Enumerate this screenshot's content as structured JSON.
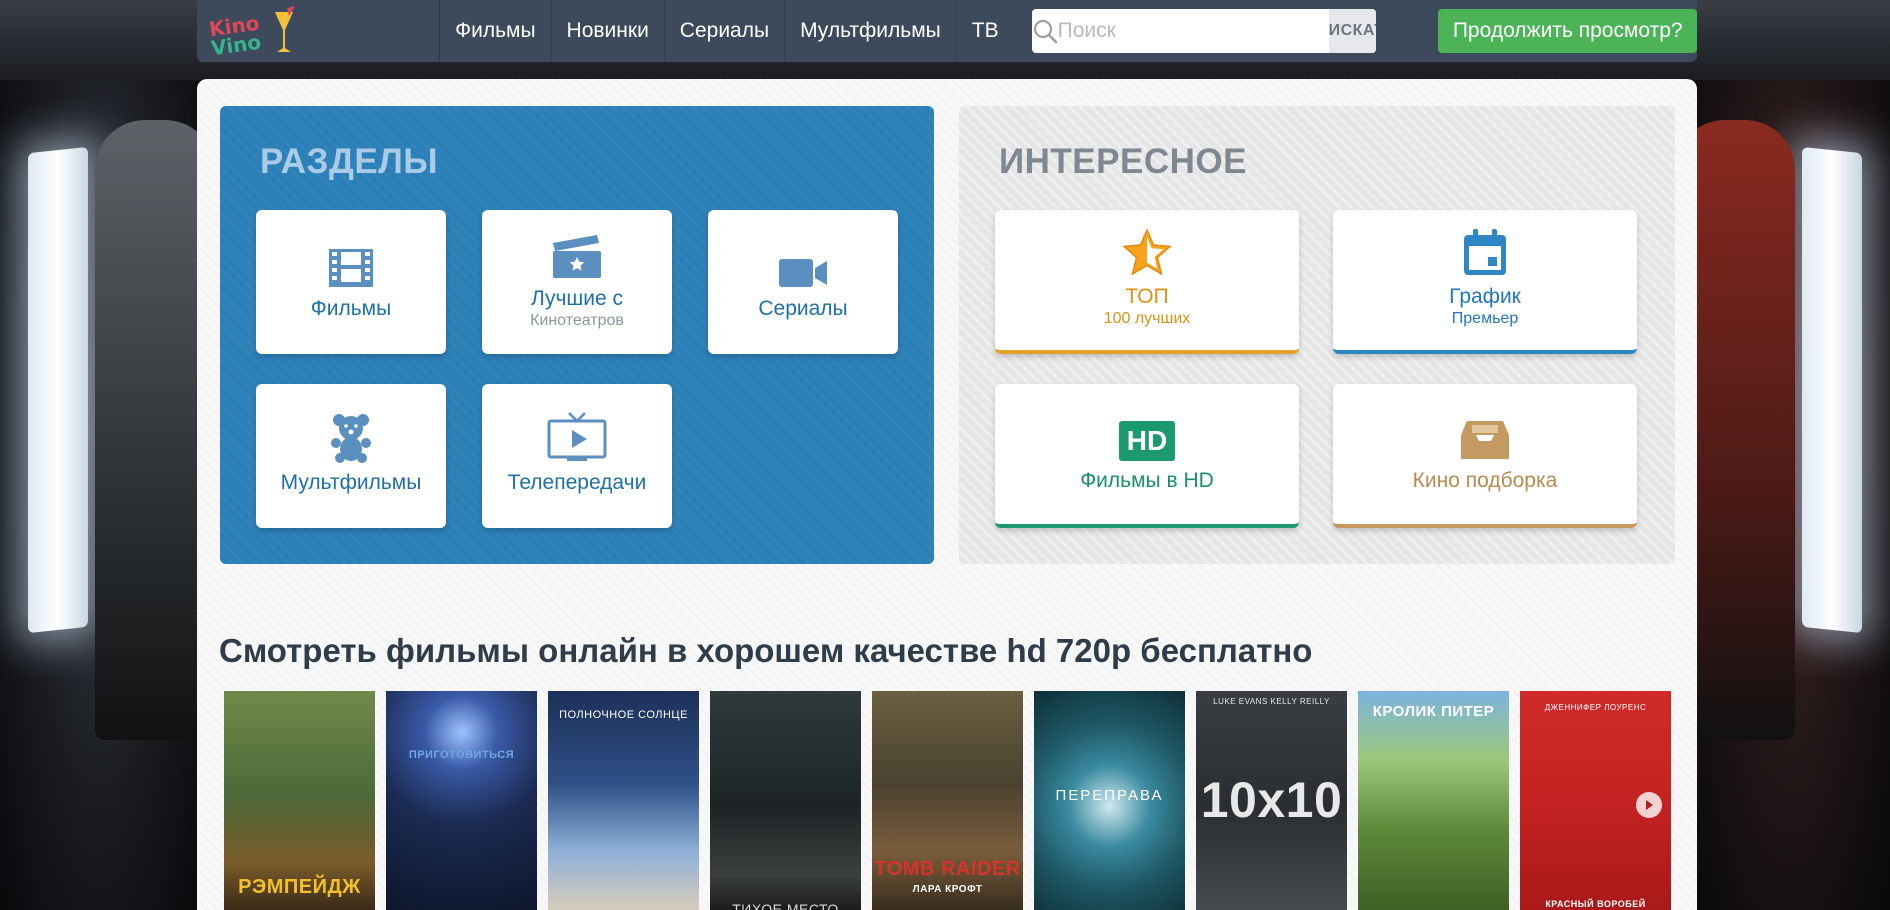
{
  "colors": {
    "topbar": "#3d4a5c",
    "sections_box": "#2c80b8",
    "continue_button": "#4cb357",
    "top_accent": "#e2a22a",
    "schedule_accent": "#2f86c5",
    "hd_accent": "#1a9a6e",
    "collection_accent": "#c49a62"
  },
  "header": {
    "logo_top": "Kino",
    "logo_bottom": "Vino",
    "nav": [
      {
        "label": "Фильмы"
      },
      {
        "label": "Новинки"
      },
      {
        "label": "Сериалы"
      },
      {
        "label": "Мультфильмы"
      },
      {
        "label": "ТВ"
      }
    ],
    "search": {
      "placeholder": "Поиск",
      "button": "ИСКАТЬ",
      "icon": "search-icon"
    },
    "continue_label": "Продолжить просмотр?"
  },
  "sections": {
    "title": "РАЗДЕЛЫ",
    "tiles": [
      {
        "label": "Фильмы",
        "sublabel": "",
        "icon": "film-icon"
      },
      {
        "label": "Лучшие с",
        "sublabel": "Кинотеатров",
        "icon": "clapperboard-icon"
      },
      {
        "label": "Сериалы",
        "sublabel": "",
        "icon": "video-camera-icon"
      },
      {
        "label": "Мультфильмы",
        "sublabel": "",
        "icon": "teddy-bear-icon"
      },
      {
        "label": "Телепередачи",
        "sublabel": "",
        "icon": "tv-icon"
      }
    ]
  },
  "interesting": {
    "title": "ИНТЕРЕСНОЕ",
    "tiles": [
      {
        "label": "ТОП",
        "sublabel": "100 лучших",
        "icon": "star-icon"
      },
      {
        "label": "График",
        "sublabel": "Премьер",
        "icon": "calendar-icon"
      },
      {
        "label": "Фильмы в HD",
        "sublabel": "",
        "icon": "hd-icon",
        "icon_text": "HD"
      },
      {
        "label": "Кино подборка",
        "sublabel": "",
        "icon": "inbox-tray-icon"
      }
    ]
  },
  "headline": "Смотреть фильмы онлайн в хорошем качестве hd 720p бесплатно",
  "posters": [
    {
      "title": "РЭМПЕЙДЖ",
      "top_text": "",
      "bg": "#4d6a3a",
      "text_color": "#f4c02a"
    },
    {
      "title": "ПРИГОТОВИТЬСЯ",
      "top_text": "",
      "bg": "#1b2b52",
      "text_color": "#6fa6e8"
    },
    {
      "title": "",
      "top_text": "ПОЛНОЧНОЕ СОЛНЦЕ",
      "bg": "#1c3158",
      "text_color": "#ffffff"
    },
    {
      "title": "ТИХОЕ МЕСТО",
      "top_text": "",
      "bg": "#1e2426",
      "text_color": "#d8d8d8"
    },
    {
      "title": "TOMB RAIDER",
      "subtitle": "ЛАРА КРОФТ",
      "top_text": "",
      "bg": "#4b4230",
      "text_color": "#d8332a"
    },
    {
      "title": "ПЕРЕПРАВА",
      "top_text": "",
      "bg": "#3a8aa0",
      "text_color": "#ffffff"
    },
    {
      "title": "10x10",
      "top_text": "LUKE EVANS   KELLY REILLY",
      "bg": "#2a2d31",
      "text_color": "#e8e8e8"
    },
    {
      "title": "",
      "top_text": "КРОЛИК ПИТЕР",
      "bg": "#5e8a3a",
      "text_color": "#ffffff"
    },
    {
      "title": "КРАСНЫЙ ВОРОБЕЙ",
      "top_text": "ДЖЕННИФЕР ЛОУРЕНС",
      "bg": "#c42222",
      "text_color": "#ffffff"
    }
  ]
}
